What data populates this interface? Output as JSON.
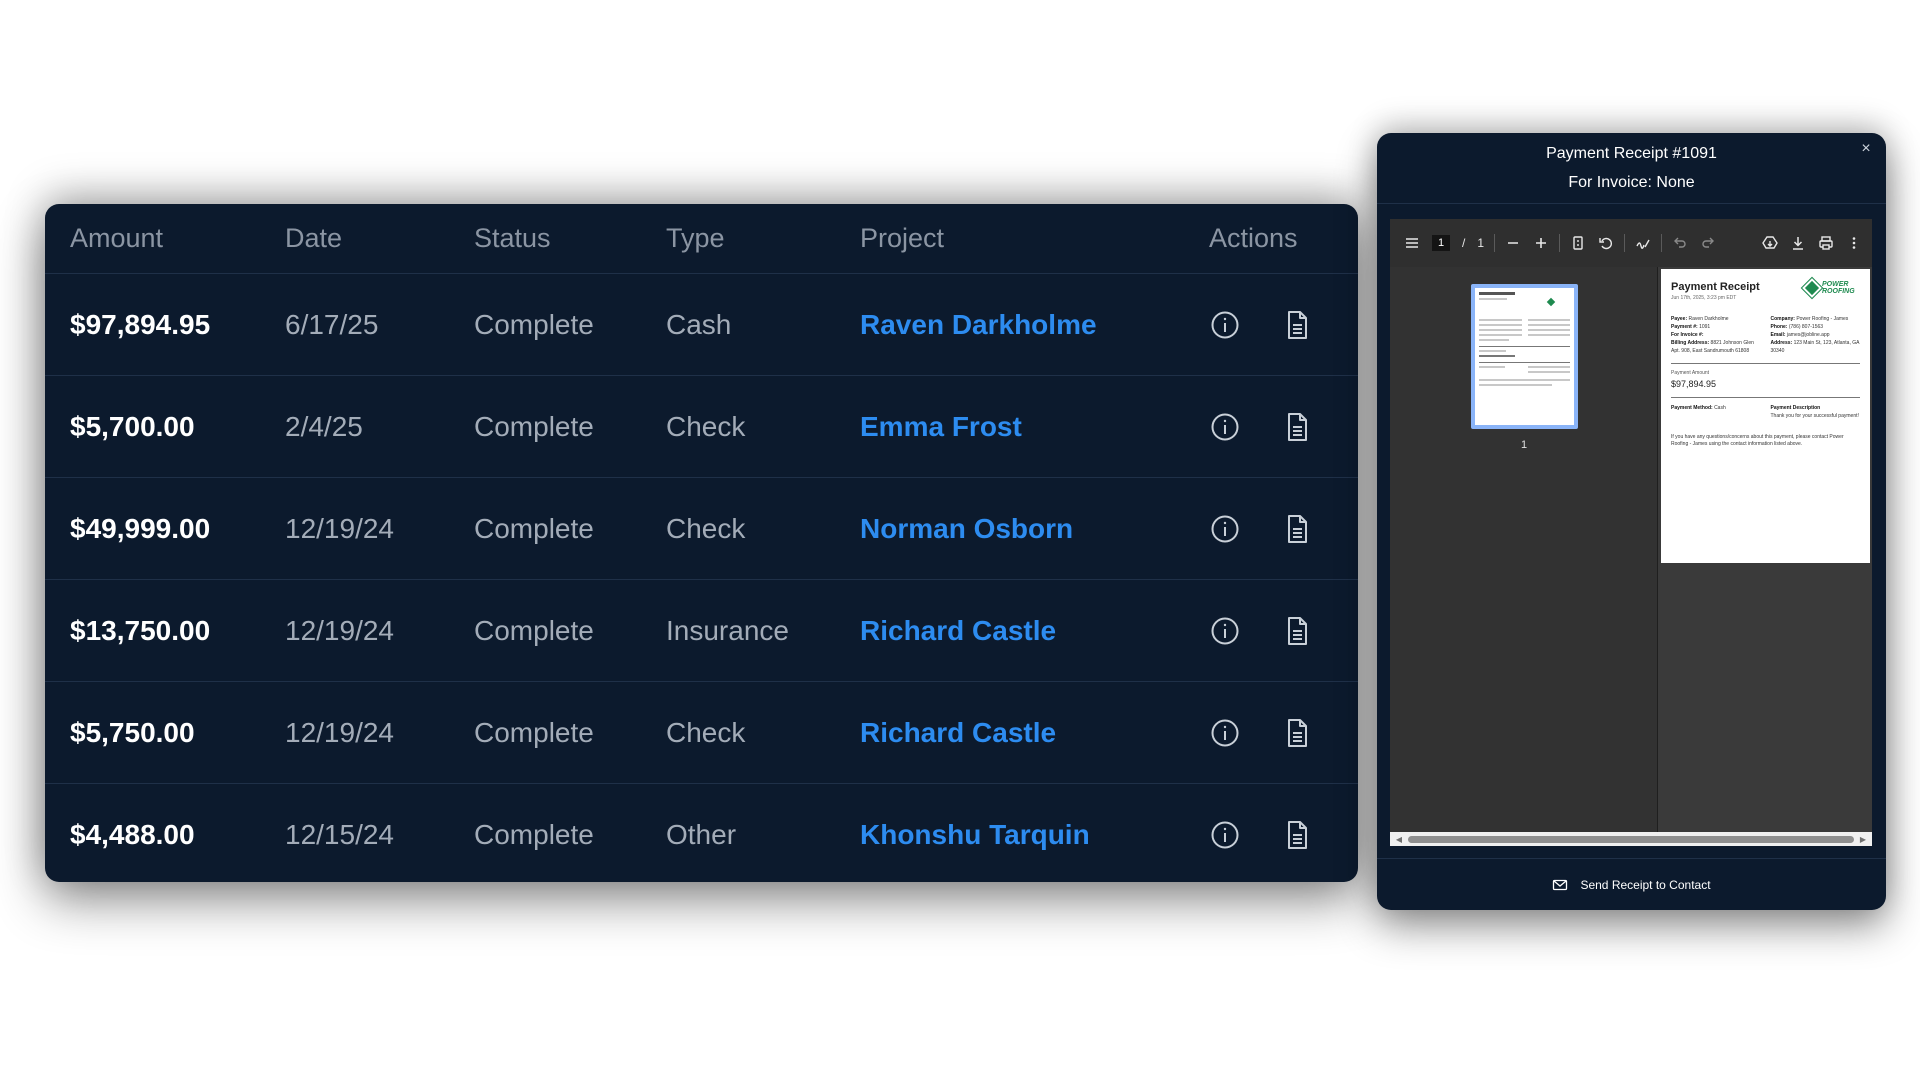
{
  "table": {
    "headers": {
      "amount": "Amount",
      "date": "Date",
      "status": "Status",
      "type": "Type",
      "project": "Project",
      "actions": "Actions"
    },
    "rows": [
      {
        "amount": "$97,894.95",
        "date": "6/17/25",
        "status": "Complete",
        "type": "Cash",
        "project": "Raven Darkholme"
      },
      {
        "amount": "$5,700.00",
        "date": "2/4/25",
        "status": "Complete",
        "type": "Check",
        "project": "Emma Frost"
      },
      {
        "amount": "$49,999.00",
        "date": "12/19/24",
        "status": "Complete",
        "type": "Check",
        "project": "Norman Osborn"
      },
      {
        "amount": "$13,750.00",
        "date": "12/19/24",
        "status": "Complete",
        "type": "Insurance",
        "project": "Richard Castle"
      },
      {
        "amount": "$5,750.00",
        "date": "12/19/24",
        "status": "Complete",
        "type": "Check",
        "project": "Richard Castle"
      },
      {
        "amount": "$4,488.00",
        "date": "12/15/24",
        "status": "Complete",
        "type": "Other",
        "project": "Khonshu Tarquin"
      }
    ]
  },
  "modal": {
    "title": "Payment Receipt #1091",
    "subtitle": "For Invoice: None",
    "close": "×",
    "viewer": {
      "current_page": "1",
      "page_sep": "/",
      "total_pages": "1",
      "thumbnail_label": "1"
    },
    "document": {
      "title": "Payment Receipt",
      "date": "Jun 17th, 2025, 3:23 pm EDT",
      "logo_text": "POWER ROOFING",
      "left": {
        "payee_label": "Payee:",
        "payee": "Raven Darkholme",
        "payment_label": "Payment #:",
        "payment": "1091",
        "invoice_label": "For Invoice #:",
        "invoice": "",
        "billing_label": "Billing Address:",
        "billing": "8821 Johnson Glen Apt. 908, East Sandrumouth 61808"
      },
      "right": {
        "company_label": "Company:",
        "company": "Power Roofing - James",
        "phone_label": "Phone:",
        "phone": "(786) 807-1563",
        "email_label": "Email:",
        "email": "james@jobline.app",
        "address_label": "Address:",
        "address": "123 Main St, 123, Atlanta, GA 30340"
      },
      "amount_label": "Payment Amount",
      "amount": "$97,894.95",
      "method_label": "Payment Method:",
      "method": "Cash",
      "description_label": "Payment Description",
      "description": "Thank you for your successful payment!",
      "footer_note": "If you have any questions/concerns about this payment, please contact Power Roofing - James using the contact information listed above."
    },
    "footer_button": "Send Receipt to Contact"
  },
  "colors": {
    "card_bg": "#0c1a2d",
    "link": "#2d8cf0",
    "muted_text": "#a3acb8",
    "header_text": "#8b95a3",
    "logo_green": "#1e8a4f"
  },
  "icons": {
    "info": "info-icon",
    "document": "document-icon",
    "close": "close-icon",
    "mail": "mail-icon"
  }
}
